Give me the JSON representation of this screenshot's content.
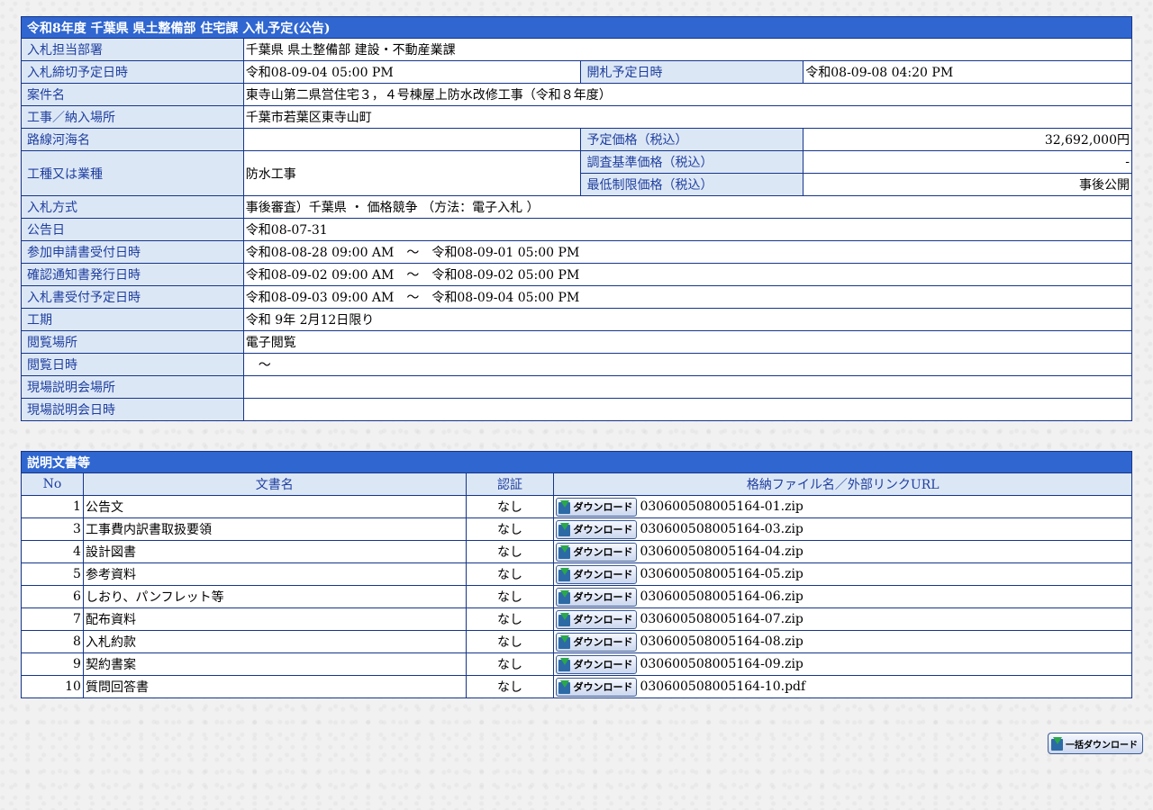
{
  "info": {
    "title": "令和8年度 千葉県 県土整備部 住宅課 入札予定(公告)",
    "rows": {
      "dept": {
        "label": "入札担当部署",
        "value": "千葉県 県土整備部 建設・不動産業課"
      },
      "deadline": {
        "label": "入札締切予定日時",
        "value": "令和08-09-04 05:00 PM"
      },
      "opening": {
        "label": "開札予定日時",
        "value": "令和08-09-08 04:20 PM"
      },
      "case": {
        "label": "案件名",
        "value": "東寺山第二県営住宅３，４号棟屋上防水改修工事（令和８年度）"
      },
      "place": {
        "label": "工事／納入場所",
        "value": "千葉市若葉区東寺山町"
      },
      "route": {
        "label": "路線河海名",
        "value": ""
      },
      "planned_price": {
        "label": "予定価格（税込）",
        "value": "32,692,000円"
      },
      "survey_price": {
        "label": "調査基準価格（税込）",
        "value": "-"
      },
      "min_price": {
        "label": "最低制限価格（税込）",
        "value": "事後公開"
      },
      "work_type": {
        "label": "工種又は業種",
        "value": "防水工事"
      },
      "method": {
        "label": "入札方式",
        "value": "事後審査）千葉県 ・ 価格競争 （方法：電子入札 ）"
      },
      "notice_date": {
        "label": "公告日",
        "value": "令和08-07-31"
      },
      "apply": {
        "label": "参加申請書受付日時",
        "value": "令和08-08-28 09:00 AM　～　令和08-09-01 05:00 PM"
      },
      "confirm": {
        "label": "確認通知書発行日時",
        "value": "令和08-09-02 09:00 AM　～　令和08-09-02 05:00 PM"
      },
      "bid_accept": {
        "label": "入札書受付予定日時",
        "value": "令和08-09-03 09:00 AM　～　令和08-09-04 05:00 PM"
      },
      "period": {
        "label": "工期",
        "value": "令和 9年 2月12日限り"
      },
      "view_place": {
        "label": "閲覧場所",
        "value": "電子閲覧"
      },
      "view_date": {
        "label": "閲覧日時",
        "value": "　～"
      },
      "site_place": {
        "label": "現場説明会場所",
        "value": ""
      },
      "site_date": {
        "label": "現場説明会日時",
        "value": ""
      }
    }
  },
  "docs": {
    "title": "説明文書等",
    "headers": {
      "no": "No",
      "name": "文書名",
      "auth": "認証",
      "file": "格納ファイル名／外部リンクURL"
    },
    "download_label": "ダウンロード",
    "rows": [
      {
        "no": "1",
        "name": "公告文",
        "auth": "なし",
        "file": "030600508005164-01.zip"
      },
      {
        "no": "3",
        "name": "工事費内訳書取扱要領",
        "auth": "なし",
        "file": "030600508005164-03.zip"
      },
      {
        "no": "4",
        "name": "設計図書",
        "auth": "なし",
        "file": "030600508005164-04.zip"
      },
      {
        "no": "5",
        "name": "参考資料",
        "auth": "なし",
        "file": "030600508005164-05.zip"
      },
      {
        "no": "6",
        "name": "しおり、パンフレット等",
        "auth": "なし",
        "file": "030600508005164-06.zip"
      },
      {
        "no": "7",
        "name": "配布資料",
        "auth": "なし",
        "file": "030600508005164-07.zip"
      },
      {
        "no": "8",
        "name": "入札約款",
        "auth": "なし",
        "file": "030600508005164-08.zip"
      },
      {
        "no": "9",
        "name": "契約書案",
        "auth": "なし",
        "file": "030600508005164-09.zip"
      },
      {
        "no": "10",
        "name": "質問回答書",
        "auth": "なし",
        "file": "030600508005164-10.pdf"
      }
    ]
  },
  "bulk_download_label": "一括ダウンロード"
}
